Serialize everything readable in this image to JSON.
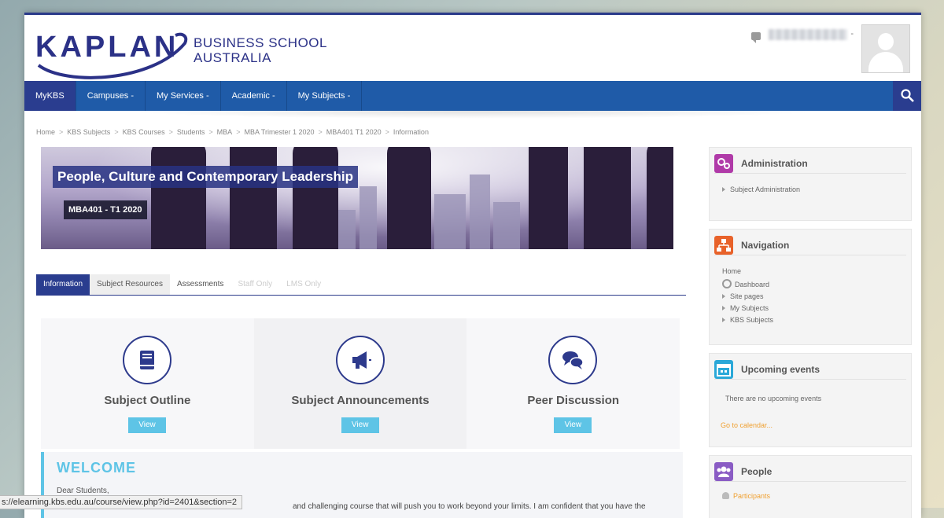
{
  "header": {
    "logo_word": "KAPLAN",
    "logo_line1": "BUSINESS SCHOOL",
    "logo_line2": "AUSTRALIA"
  },
  "nav": {
    "items": [
      {
        "label": "MyKBS"
      },
      {
        "label": "Campuses -"
      },
      {
        "label": "My Services -"
      },
      {
        "label": "Academic -"
      },
      {
        "label": "My Subjects -"
      }
    ],
    "user_caret": "-"
  },
  "breadcrumb": [
    "Home",
    "KBS Subjects",
    "KBS Courses",
    "Students",
    "MBA",
    "MBA Trimester 1 2020",
    "MBA401 T1 2020",
    "Information"
  ],
  "banner": {
    "title": "People, Culture and Contemporary Leadership",
    "code": "MBA401 - T1 2020"
  },
  "tabs": [
    {
      "label": "Information"
    },
    {
      "label": "Subject Resources"
    },
    {
      "label": "Assessments"
    },
    {
      "label": "Staff Only"
    },
    {
      "label": "LMS Only"
    }
  ],
  "cards": [
    {
      "title": "Subject Outline",
      "button": "View",
      "icon": "book-icon"
    },
    {
      "title": "Subject Announcements",
      "button": "View",
      "icon": "megaphone-icon"
    },
    {
      "title": "Peer Discussion",
      "button": "View",
      "icon": "chat-bubbles-icon"
    }
  ],
  "welcome": {
    "heading": "WELCOME",
    "greeting": "Dear Students,",
    "text": "and challenging course that will push you to work beyond your limits. I am confident that you have the"
  },
  "sidebar": {
    "administration": {
      "title": "Administration",
      "items": [
        "Subject Administration"
      ],
      "color": "#b03aa8"
    },
    "navigation": {
      "title": "Navigation",
      "home": "Home",
      "items": [
        "Dashboard",
        "Site pages",
        "My Subjects",
        "KBS Subjects"
      ],
      "color": "#e8622a"
    },
    "upcoming": {
      "title": "Upcoming events",
      "empty": "There are no upcoming events",
      "link": "Go to calendar...",
      "color": "#2aa8d8"
    },
    "people": {
      "title": "People",
      "link": "Participants",
      "color": "#8a5cc4"
    }
  },
  "status_url": "s://elearning.kbs.edu.au/course/view.php?id=2401&section=2",
  "colors": {
    "nav": "#1f5ba8",
    "accent": "#2a3d8f",
    "button": "#5ec4e6"
  }
}
